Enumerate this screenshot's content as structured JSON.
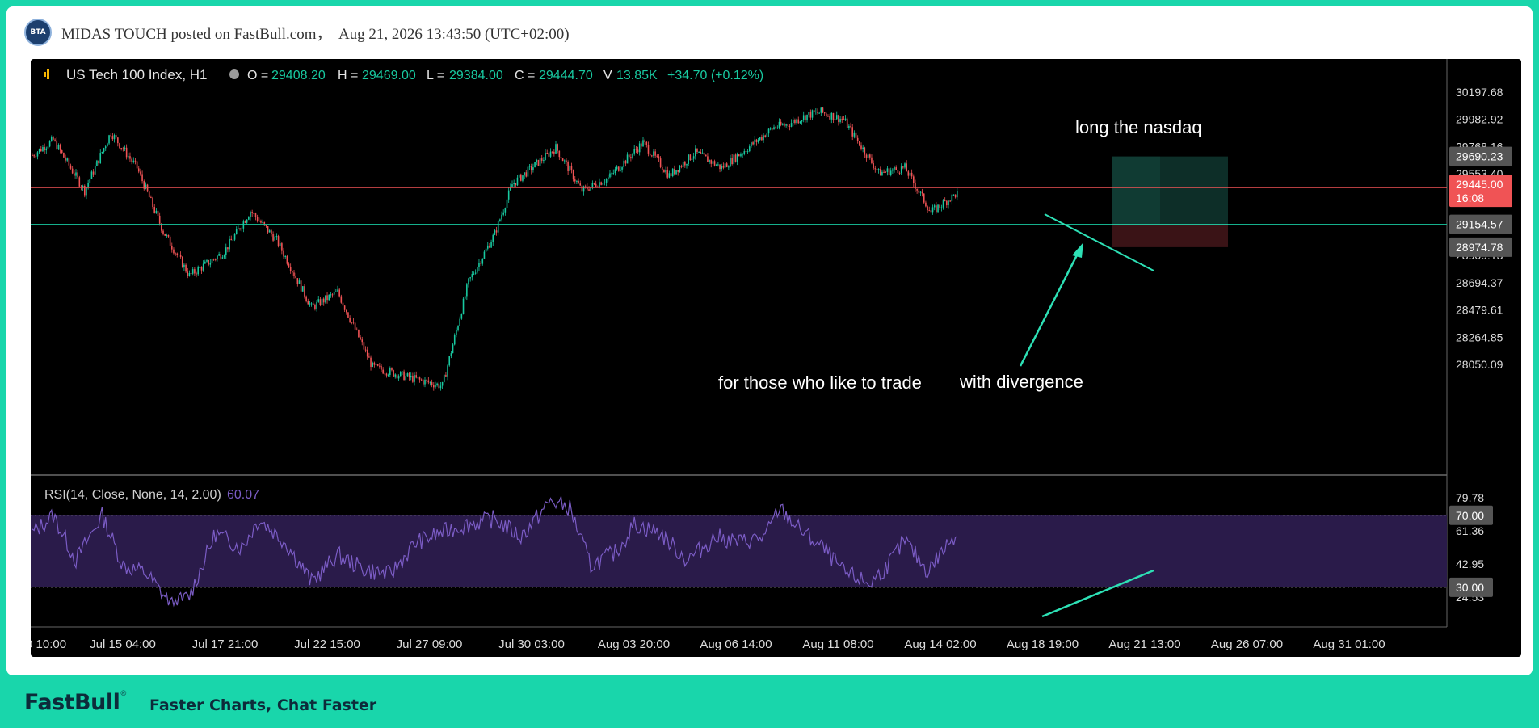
{
  "post": {
    "avatar_text": "BTA",
    "author": "MIDAS TOUCH",
    "posted_on": "posted on FastBull.com，",
    "datetime": "Aug 21, 2026 13:43:50 (UTC+02:00)"
  },
  "chart_data": {
    "type": "candlestick",
    "symbol": "US Tech 100 Index, H1",
    "ohlc": {
      "o_label": "O =",
      "o": "29408.20",
      "h_label": "H =",
      "h": "29469.00",
      "l_label": "L =",
      "l": "29384.00",
      "c_label": "C =",
      "c": "29444.70",
      "v_label": "V",
      "v": "13.85K",
      "change": "+34.70 (+0.12%)"
    },
    "price_axis": [
      "30197.68",
      "29982.92",
      "29768.16",
      "29553.40",
      "28909.13",
      "28694.37",
      "28479.61",
      "28264.85",
      "28050.09"
    ],
    "price_tags": [
      {
        "value": "29690.23",
        "color": "#555555"
      },
      {
        "value": "29445.00",
        "sub": "16:08",
        "color": "#f05355"
      },
      {
        "value": "29154.57",
        "color": "#555555"
      },
      {
        "value": "28974.78",
        "color": "#555555"
      }
    ],
    "time_axis": [
      "0 10:00",
      "Jul 15 04:00",
      "Jul 17 21:00",
      "Jul 22 15:00",
      "Jul 27 09:00",
      "Jul 30 03:00",
      "Aug 03 20:00",
      "Aug 06 14:00",
      "Aug 11 08:00",
      "Aug 14 02:00",
      "Aug 18 19:00",
      "Aug 21 13:00",
      "Aug 26 07:00",
      "Aug 31 01:00"
    ],
    "series_anchors": [
      [
        0,
        29700
      ],
      [
        12,
        29820
      ],
      [
        30,
        29420
      ],
      [
        45,
        29880
      ],
      [
        60,
        29600
      ],
      [
        75,
        29100
      ],
      [
        90,
        28750
      ],
      [
        110,
        28940
      ],
      [
        125,
        29260
      ],
      [
        140,
        29030
      ],
      [
        160,
        28500
      ],
      [
        175,
        28620
      ],
      [
        195,
        28030
      ],
      [
        215,
        27950
      ],
      [
        235,
        27880
      ],
      [
        250,
        28700
      ],
      [
        265,
        29080
      ],
      [
        275,
        29470
      ],
      [
        300,
        29760
      ],
      [
        315,
        29420
      ],
      [
        330,
        29520
      ],
      [
        350,
        29800
      ],
      [
        365,
        29540
      ],
      [
        380,
        29720
      ],
      [
        395,
        29600
      ],
      [
        412,
        29780
      ],
      [
        425,
        29920
      ],
      [
        432,
        29940
      ],
      [
        445,
        30020
      ],
      [
        452,
        30040
      ],
      [
        465,
        29980
      ],
      [
        485,
        29560
      ],
      [
        500,
        29600
      ],
      [
        515,
        29250
      ],
      [
        530,
        29400
      ]
    ],
    "rsi": {
      "label": "RSI(14, Close, None, 14, 2.00)",
      "value": "60.07",
      "axis": [
        "79.78",
        "61.36",
        "42.95",
        "24.53"
      ],
      "band_tags": [
        "70.00",
        "30.00"
      ],
      "upper": 70,
      "lower": 30,
      "anchors": [
        [
          0,
          60
        ],
        [
          12,
          70
        ],
        [
          25,
          45
        ],
        [
          40,
          70
        ],
        [
          52,
          42
        ],
        [
          65,
          38
        ],
        [
          80,
          20
        ],
        [
          90,
          25
        ],
        [
          105,
          60
        ],
        [
          120,
          52
        ],
        [
          130,
          68
        ],
        [
          145,
          55
        ],
        [
          160,
          33
        ],
        [
          175,
          48
        ],
        [
          190,
          40
        ],
        [
          205,
          37
        ],
        [
          220,
          55
        ],
        [
          245,
          64
        ],
        [
          265,
          68
        ],
        [
          280,
          58
        ],
        [
          297,
          78
        ],
        [
          308,
          74
        ],
        [
          320,
          42
        ],
        [
          335,
          50
        ],
        [
          345,
          65
        ],
        [
          360,
          60
        ],
        [
          375,
          45
        ],
        [
          392,
          58
        ],
        [
          405,
          55
        ],
        [
          420,
          58
        ],
        [
          428,
          74
        ],
        [
          440,
          62
        ],
        [
          455,
          50
        ],
        [
          465,
          38
        ],
        [
          480,
          32
        ],
        [
          490,
          42
        ],
        [
          500,
          56
        ],
        [
          513,
          39
        ],
        [
          530,
          61
        ]
      ]
    },
    "horizontal_lines": [
      {
        "value": 29445,
        "color": "#f05355"
      },
      {
        "value": 29154.57,
        "color": "#18c9a0"
      }
    ],
    "position_box": {
      "entry": 29154.57,
      "target": 29690.23,
      "stop": 28974.78
    },
    "annotations": {
      "long": "long the nasdaq",
      "trade": "for those who like to trade",
      "divergence": "with divergence"
    },
    "colors": {
      "up": "#18c9a0",
      "down": "#f05355",
      "rsi": "#7b5cc5",
      "rsi_band": "#2a1b4a"
    }
  },
  "footer": {
    "brand": "FastBull",
    "reg": "®",
    "tagline": "Faster Charts, Chat Faster"
  }
}
